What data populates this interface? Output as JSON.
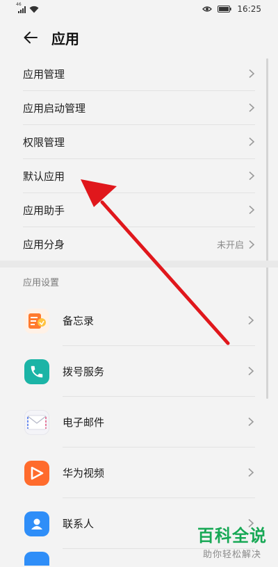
{
  "status_bar": {
    "network": "46",
    "time": "16:25"
  },
  "header": {
    "title": "应用"
  },
  "settings": [
    {
      "label": "应用管理",
      "value": ""
    },
    {
      "label": "应用启动管理",
      "value": ""
    },
    {
      "label": "权限管理",
      "value": ""
    },
    {
      "label": "默认应用",
      "value": ""
    },
    {
      "label": "应用助手",
      "value": ""
    },
    {
      "label": "应用分身",
      "value": "未开启"
    }
  ],
  "section": {
    "title": "应用设置"
  },
  "apps": [
    {
      "label": "备忘录",
      "icon": "memo-icon",
      "color": "#ff7a2e"
    },
    {
      "label": "拨号服务",
      "icon": "phone-icon",
      "color": "#1bb4a6"
    },
    {
      "label": "电子邮件",
      "icon": "mail-icon",
      "color": "#f4f4f8"
    },
    {
      "label": "华为视频",
      "icon": "video-icon",
      "color": "#ff6b2c"
    },
    {
      "label": "联系人",
      "icon": "contacts-icon",
      "color": "#2f8ef8"
    }
  ],
  "watermark": {
    "title": "百科全说",
    "subtitle": "助你轻松解决"
  },
  "colors": {
    "arrow": "#e0171c",
    "accent": "#17a855"
  }
}
